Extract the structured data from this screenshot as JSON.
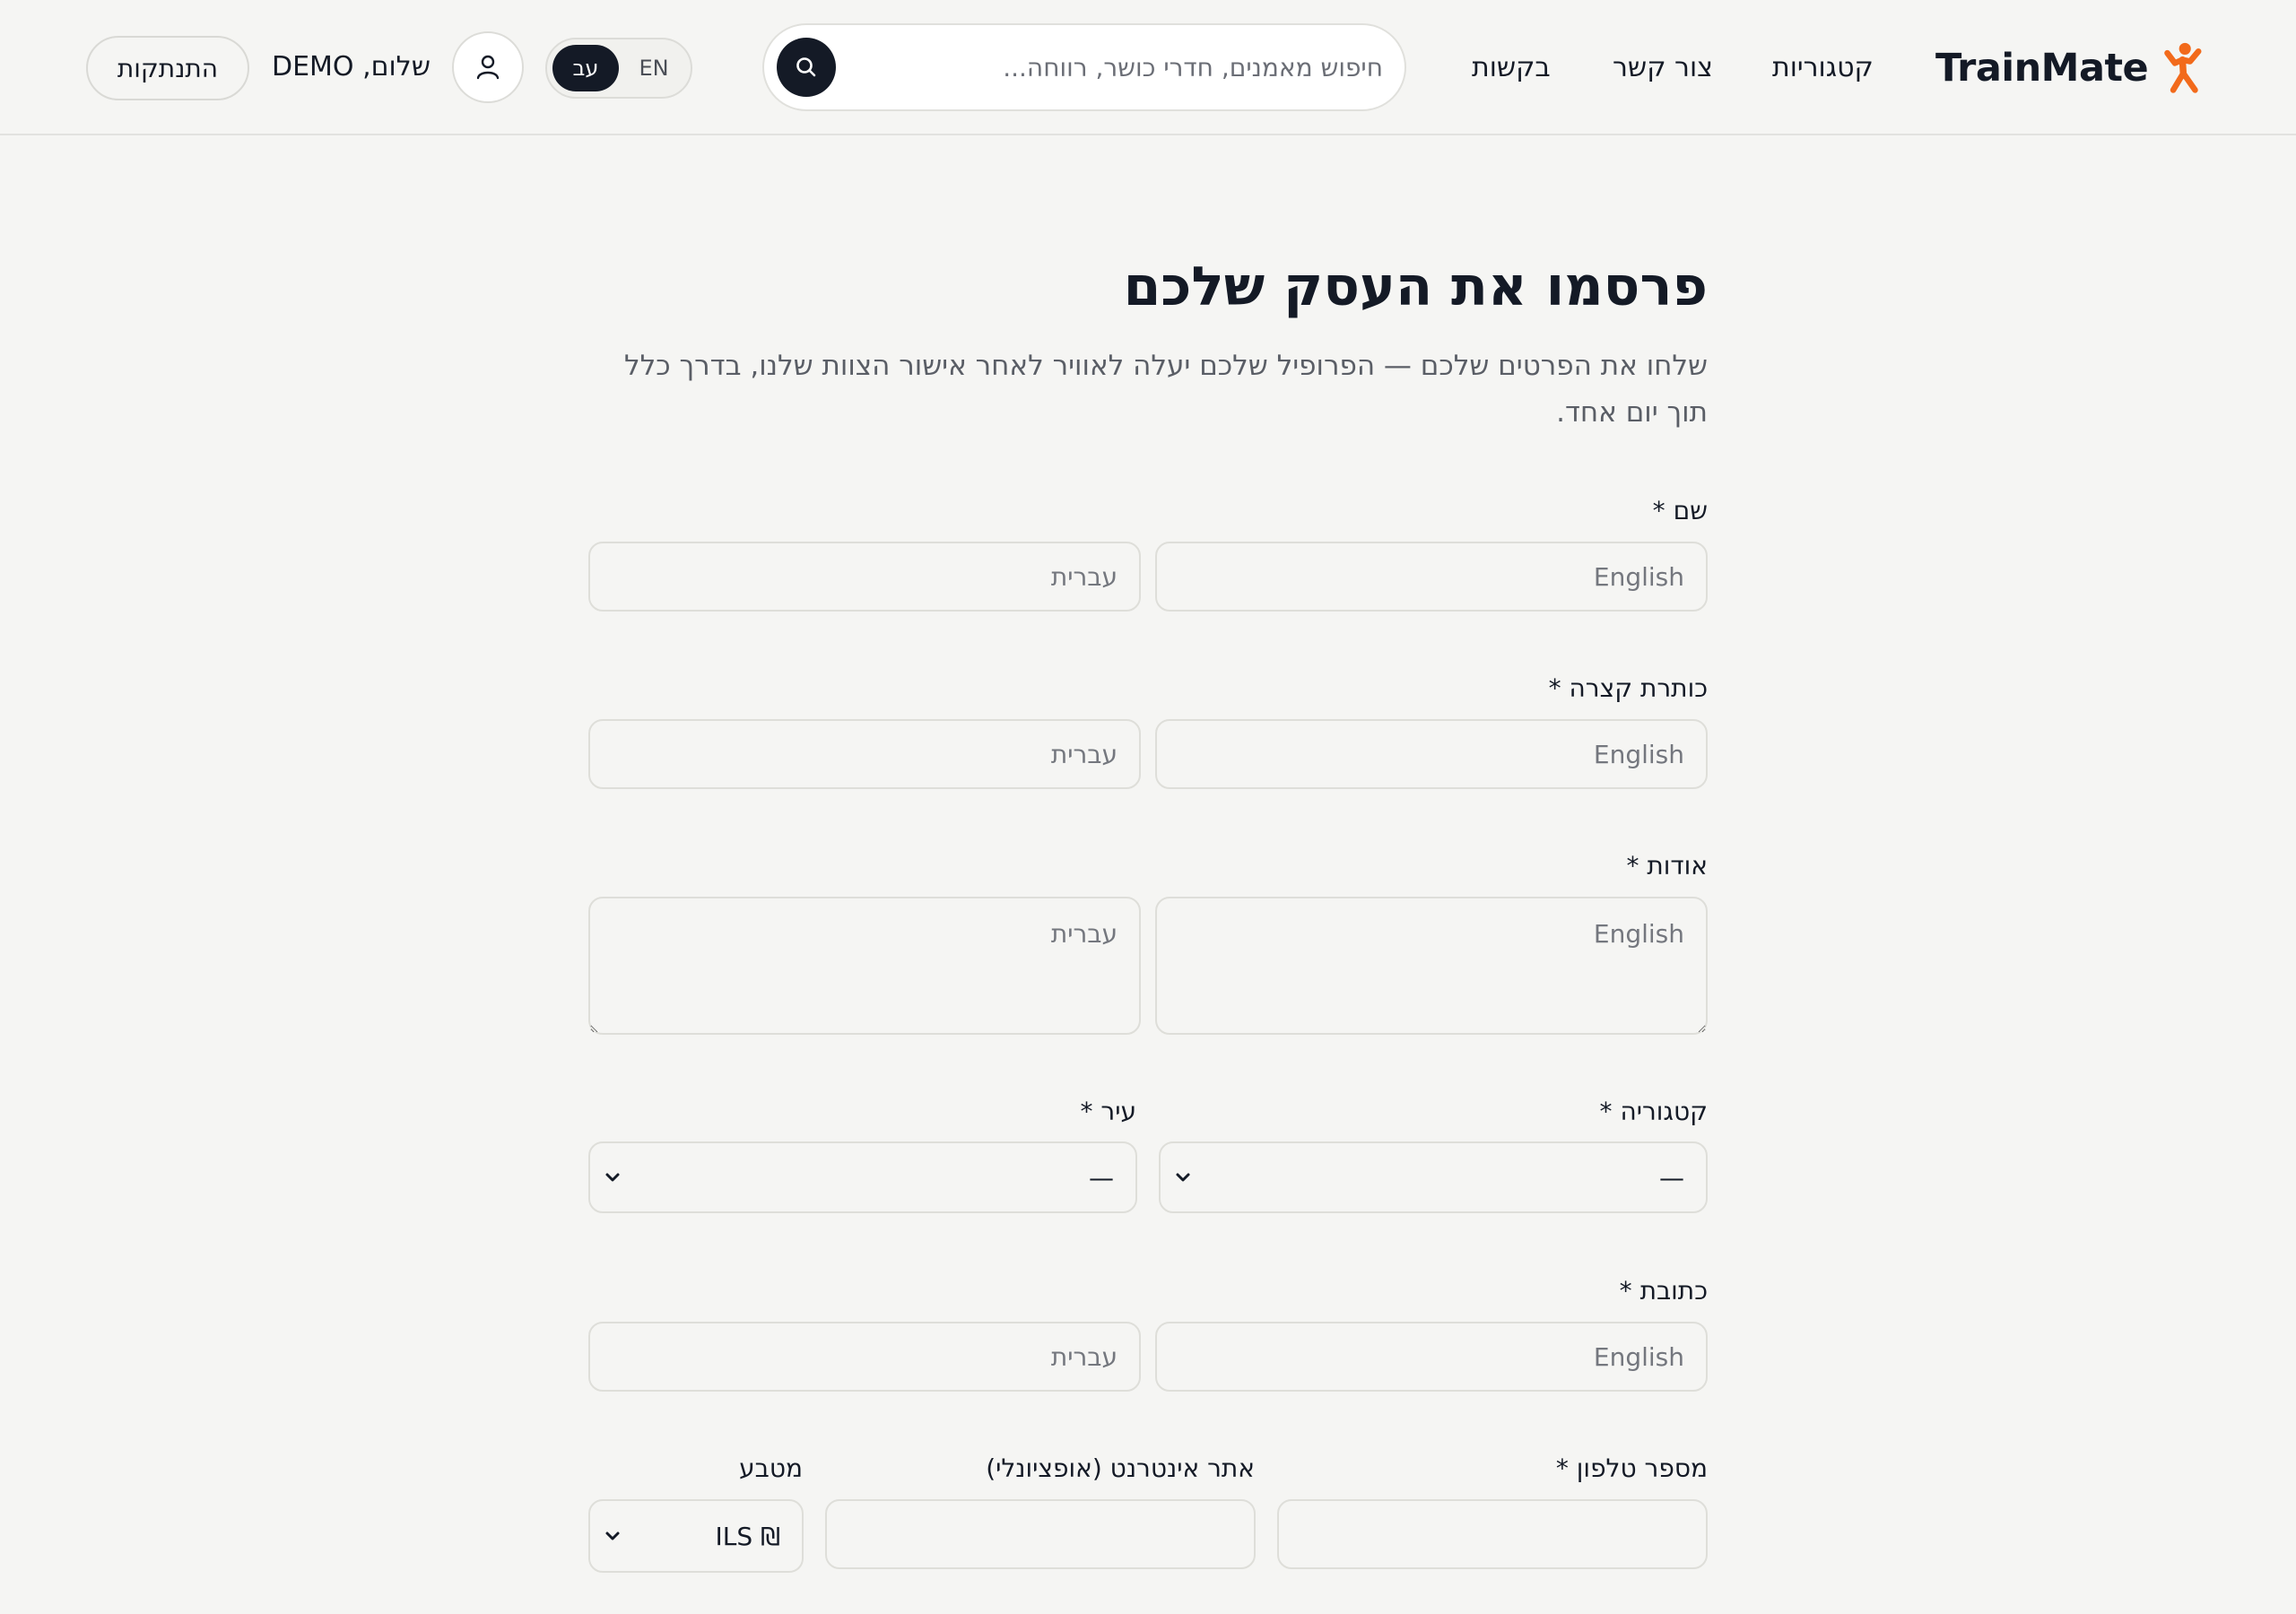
{
  "header": {
    "brand": "TrainMate",
    "nav": {
      "categories": "קטגוריות",
      "contact": "צור קשר",
      "requests": "בקשות"
    },
    "search": {
      "placeholder": "חיפוש מאמנים, חדרי כושר, רווחה..."
    },
    "language": {
      "en_label": "EN",
      "he_label": "עב",
      "selected": "he"
    },
    "greeting": "שלום, DEMO",
    "logout_label": "התנתקות"
  },
  "form": {
    "title": "פרסמו את העסק שלכם",
    "subtitle": "שלחו את הפרטים שלכם — הפרופיל שלכם יעלה לאוויר לאחר אישור הצוות שלנו, בדרך כלל תוך יום אחד.",
    "name": {
      "label": "שם *",
      "english_placeholder": "English",
      "hebrew_placeholder": "עברית"
    },
    "tagline": {
      "label": "כותרת קצרה *",
      "english_placeholder": "English",
      "hebrew_placeholder": "עברית"
    },
    "about": {
      "label": "אודות *",
      "english_placeholder": "English",
      "hebrew_placeholder": "עברית"
    },
    "category": {
      "label": "קטגוריה *",
      "value": "—"
    },
    "city": {
      "label": "עיר *",
      "value": "—"
    },
    "address": {
      "label": "כתובת *",
      "english_placeholder": "English",
      "hebrew_placeholder": "עברית"
    },
    "phone": {
      "label": "מספר טלפון *",
      "value": ""
    },
    "website": {
      "label": "אתר אינטרנט (אופציונלי)",
      "value": ""
    },
    "currency": {
      "label": "מטבע",
      "value": "₪ ILS"
    }
  },
  "colors": {
    "accent": "#f26a1b",
    "dark": "#141a26",
    "background": "#f5f5f3"
  },
  "icons": {
    "logo": "figure-flexing-icon",
    "search": "search-icon",
    "user": "user-icon",
    "chevron": "chevron-down-icon"
  }
}
